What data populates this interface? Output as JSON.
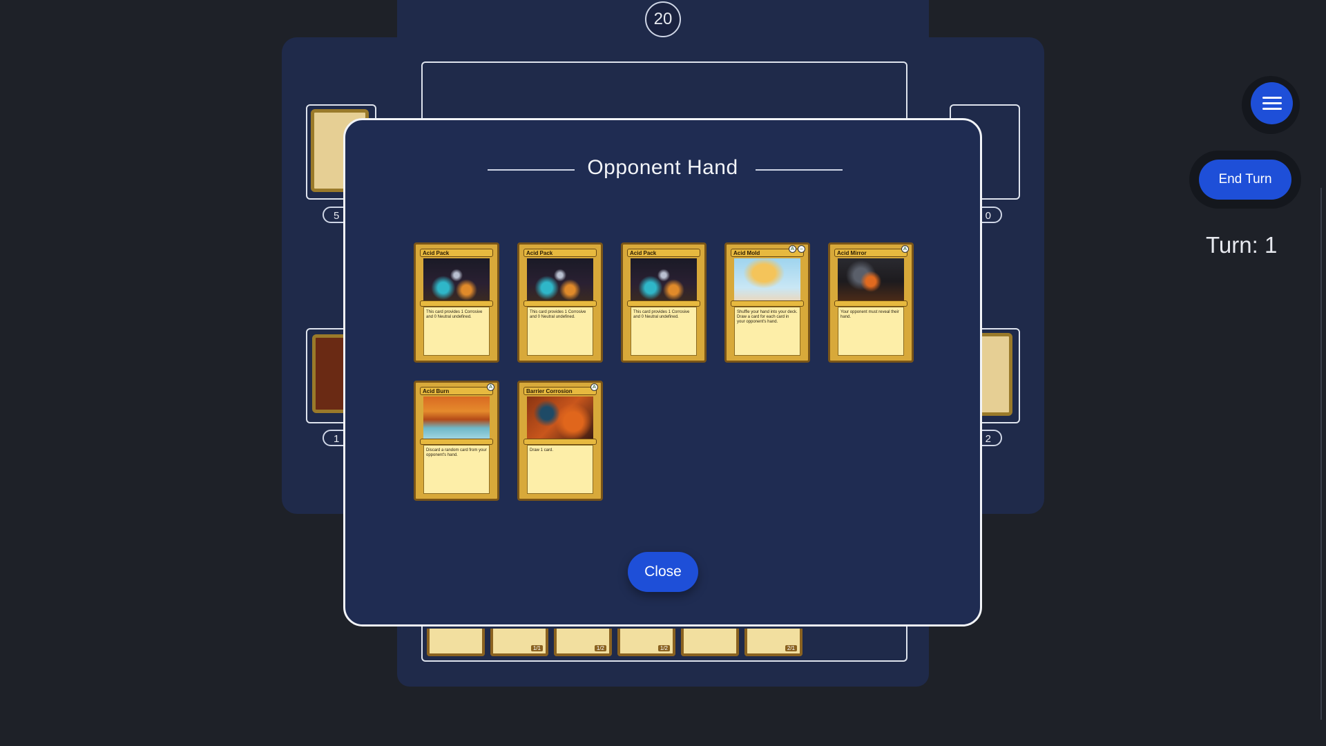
{
  "board": {
    "life": "20",
    "left_deck_count": "5",
    "left_hand_count": "1",
    "right_discard_count": "0",
    "right_deck_count": "2"
  },
  "controls": {
    "end_turn_label": "End Turn",
    "turn_label": "Turn: 1",
    "menu_icon": "hamburger-menu-icon"
  },
  "modal": {
    "title": "Opponent Hand",
    "close_label": "Close",
    "cards": [
      {
        "name": "Acid Pack",
        "text": "This card provides 1 Corrosive and 0 Neutral undefined.",
        "art": "art-pack",
        "cost": []
      },
      {
        "name": "Acid Pack",
        "text": "This card provides 1 Corrosive and 0 Neutral undefined.",
        "art": "art-pack",
        "cost": []
      },
      {
        "name": "Acid Pack",
        "text": "This card provides 1 Corrosive and 0 Neutral undefined.",
        "art": "art-pack",
        "cost": []
      },
      {
        "name": "Acid Mold",
        "text": "Shuffle your hand into your deck. Draw a card for each card in your opponent's hand.",
        "art": "art-mold",
        "cost": [
          "A",
          "–"
        ]
      },
      {
        "name": "Acid Mirror",
        "text": "Your opponent must reveal their hand.",
        "art": "art-mirror",
        "cost": [
          "A"
        ]
      },
      {
        "name": "Acid Burn",
        "text": "Discard a random card from your opponent's hand.",
        "art": "art-burn",
        "cost": [
          "A"
        ]
      },
      {
        "name": "Barrier Corrosion",
        "text": "Draw 1 card.",
        "art": "art-barrier",
        "cost": [
          "A"
        ]
      }
    ]
  },
  "colors": {
    "accent": "#1e4fd8",
    "board": "#1f2a4a",
    "modal": "#1f2c52",
    "card_frame": "#d8a93a"
  }
}
